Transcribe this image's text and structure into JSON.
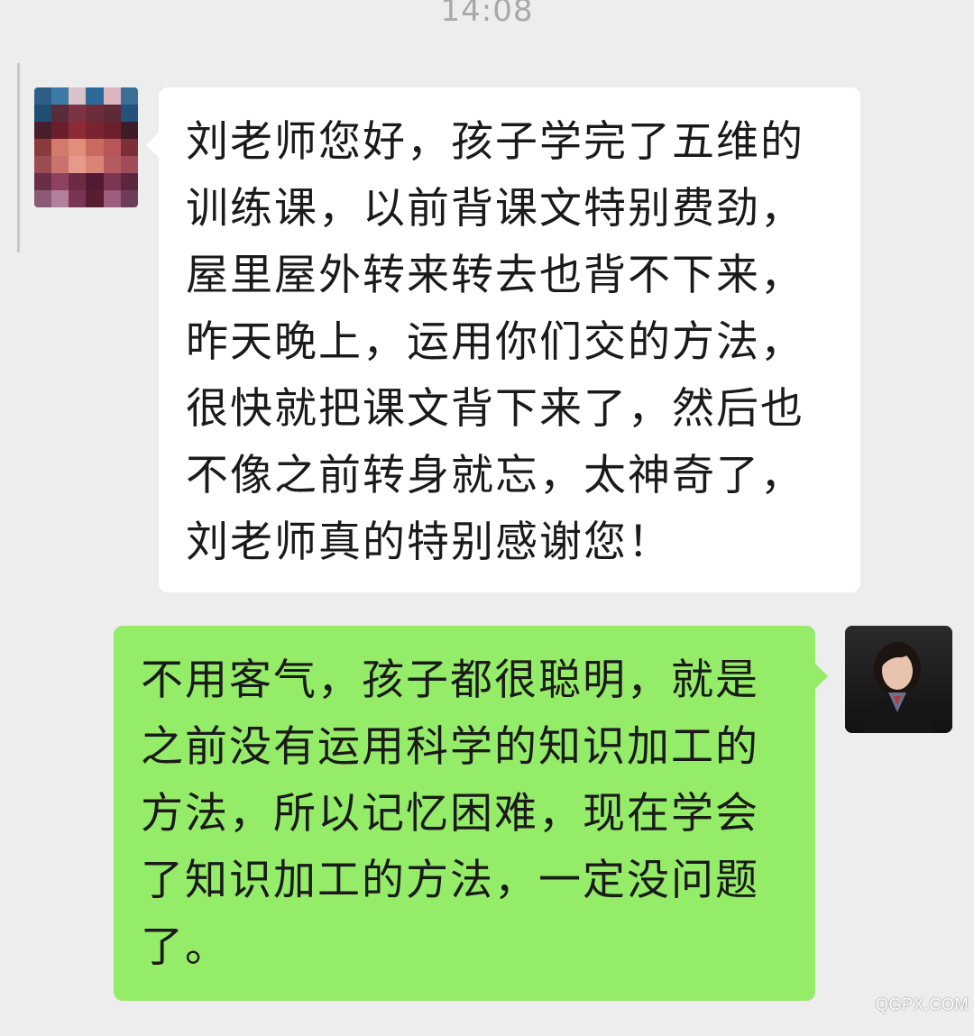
{
  "chat": {
    "timestamp": "14:08",
    "messages": [
      {
        "side": "left",
        "text": "刘老师您好，孩子学完了五维的\n训练课，以前背课文特别费劲，\n屋里屋外转来转去也背不下来，\n昨天晚上，运用你们交的方法，\n很快就把课文背下来了，然后也\n不像之前转身就忘，太神奇了，\n刘老师真的特别感谢您！"
      },
      {
        "side": "right",
        "text": "不用客气，孩子都很聪明，就是\n之前没有运用科学的知识加工的\n方法，所以记忆困难，现在学会\n了知识加工的方法，一定没问题\n了。"
      }
    ]
  },
  "watermark": "QGPX.COM",
  "colors": {
    "background": "#ededed",
    "incoming_bubble": "#ffffff",
    "outgoing_bubble": "#95ec69",
    "timestamp": "#a8a8a8"
  },
  "icons": {
    "left_avatar": "mosaic-avatar-icon",
    "right_avatar": "user-photo-avatar-icon"
  }
}
